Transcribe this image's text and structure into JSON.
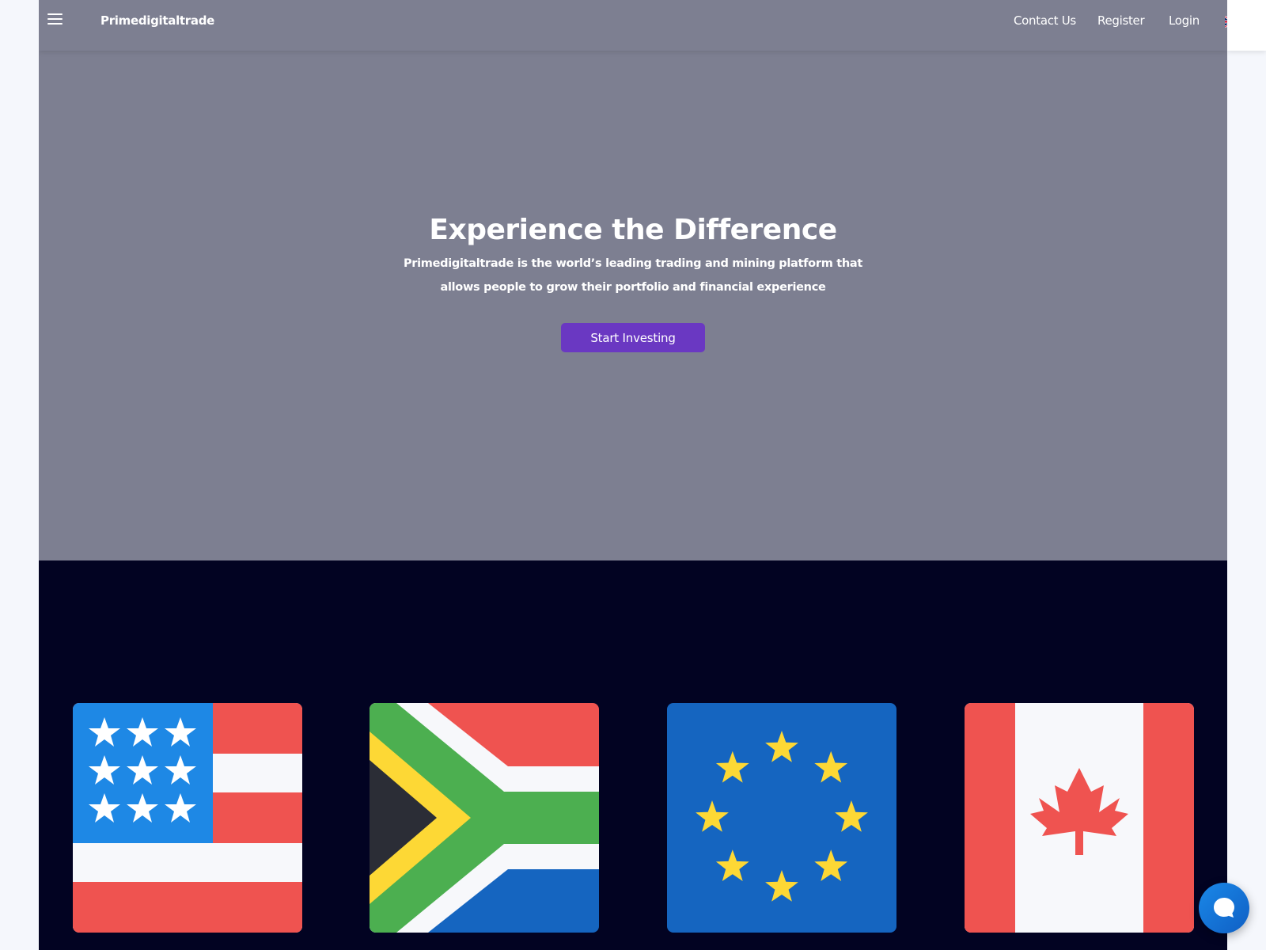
{
  "navbar": {
    "brand": "Primedigitaltrade",
    "links": {
      "contact": "Contact Us",
      "register": "Register",
      "login": "Login"
    },
    "menu_icon": "hamburger-menu-icon",
    "language_icon": "uk-flag-icon"
  },
  "hero": {
    "title": "Experience the Difference",
    "subtitle": "Primedigitaltrade is the world’s leading trading and mining platform that allows people to grow their portfolio and financial experience",
    "cta_label": "Start Investing"
  },
  "flags": [
    {
      "name": "usa-flag-icon"
    },
    {
      "name": "south-africa-flag-icon"
    },
    {
      "name": "eu-flag-icon"
    },
    {
      "name": "canada-flag-icon"
    }
  ],
  "chat": {
    "icon": "chat-bubble-icon"
  },
  "colors": {
    "hero_bg": "#7d7f91",
    "dark_bg": "#020322",
    "accent": "#6a38c2",
    "chat": "#1a88e8"
  }
}
